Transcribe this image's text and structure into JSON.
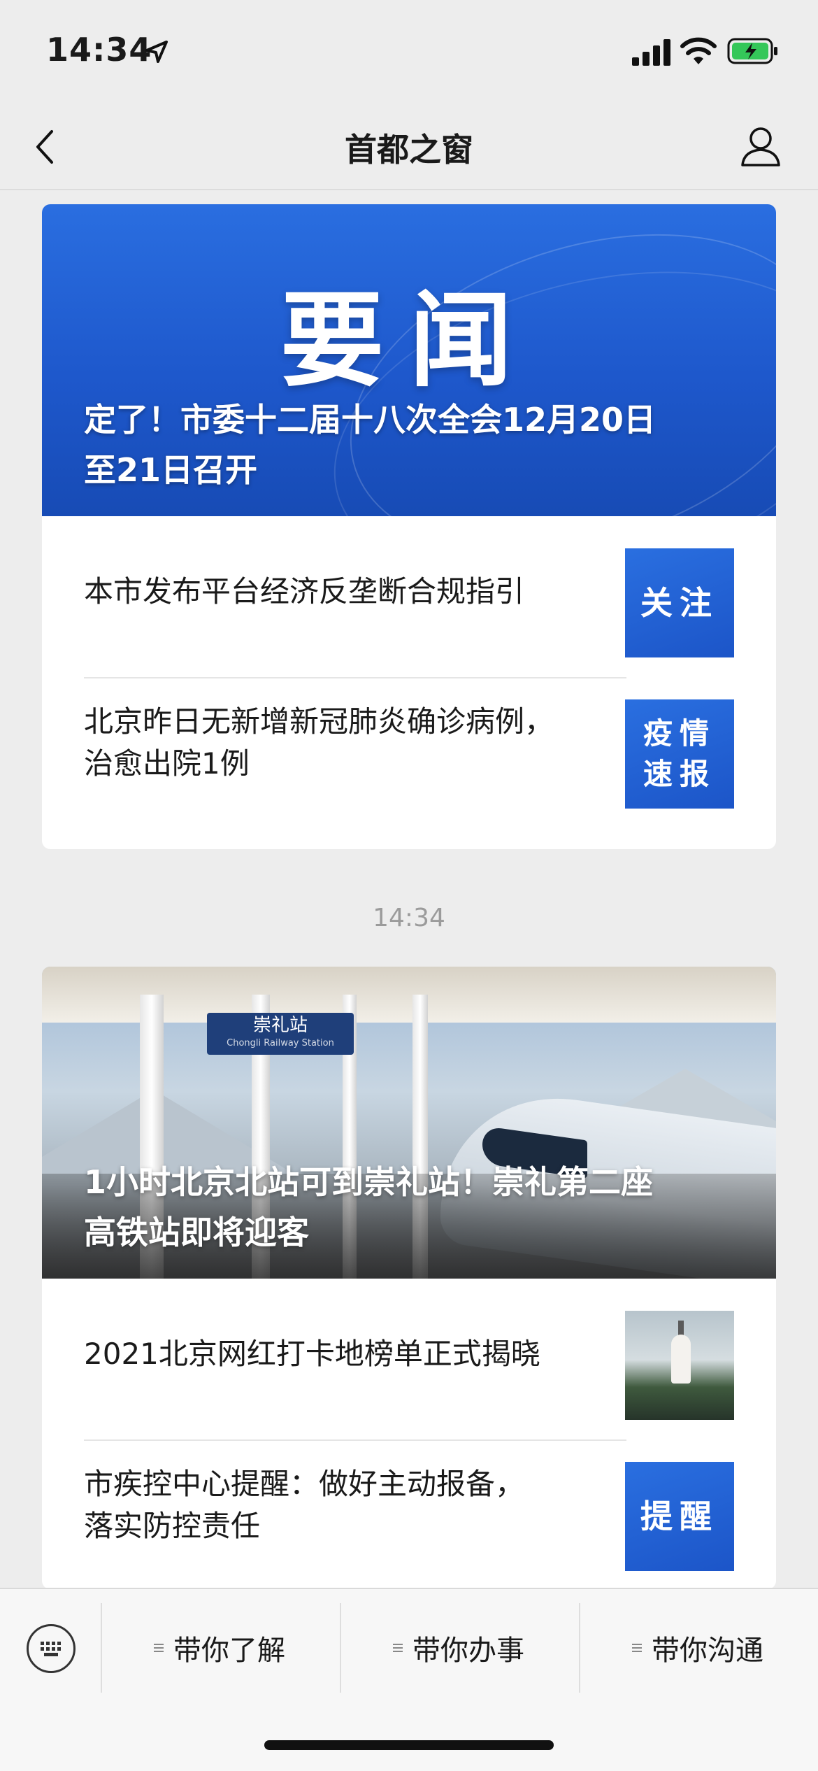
{
  "status_bar": {
    "time": "14:34"
  },
  "nav": {
    "title": "首都之窗"
  },
  "card1": {
    "hero_big": "要闻",
    "hero_caption_line1": "定了！市委十二届十八次全会12月20日",
    "hero_caption_line2": "至21日召开",
    "items": [
      {
        "title_line1": "本市发布平台经济反垄断合规指引",
        "title_line2": "",
        "thumb_text_line1": "关注",
        "thumb_text_line2": ""
      },
      {
        "title_line1": "北京昨日无新增新冠肺炎确诊病例，",
        "title_line2": "治愈出院1例",
        "thumb_text_line1": "疫情",
        "thumb_text_line2": "速报"
      }
    ]
  },
  "timestamp": "14:34",
  "card2": {
    "station_sign": "崇礼站",
    "station_sign_en": "Chongli Railway Station",
    "hero_caption_line1": "1小时北京北站可到崇礼站！崇礼第二座",
    "hero_caption_line2": "高铁站即将迎客",
    "items": [
      {
        "title_line1": "2021北京网红打卡地榜单正式揭晓",
        "title_line2": ""
      },
      {
        "title_line1": "市疾控中心提醒：做好主动报备，",
        "title_line2": "落实防控责任",
        "thumb_text_line1": "提醒"
      }
    ]
  },
  "menu": {
    "items": [
      "带你了解",
      "带你办事",
      "带你沟通"
    ]
  },
  "colors": {
    "accent_blue": "#1e58cc",
    "background": "#ededed"
  }
}
